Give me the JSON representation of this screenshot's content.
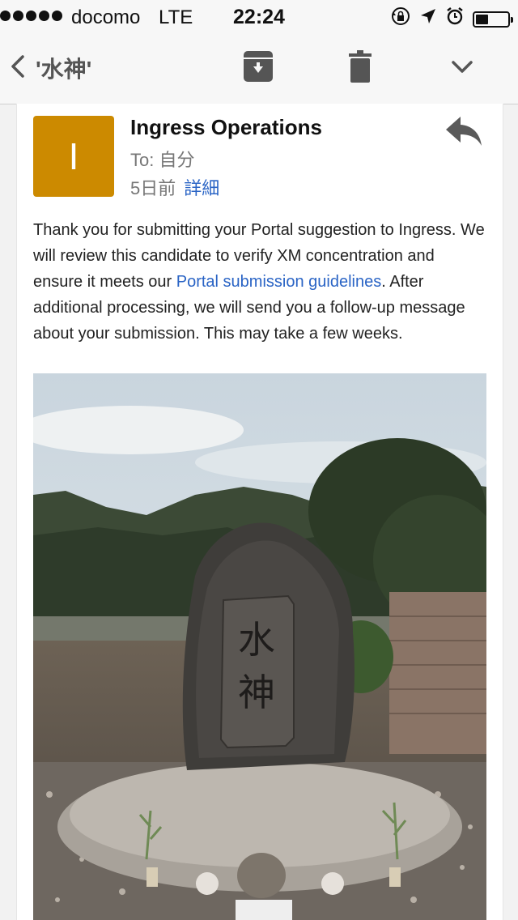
{
  "status_bar": {
    "carrier": "docomo",
    "network": "LTE",
    "time": "22:24",
    "signal_bars": 5,
    "battery_level_percent": 40
  },
  "nav": {
    "title": "'水神'",
    "back_icon": "chevron-left-icon",
    "archive_icon": "archive-icon",
    "delete_icon": "trash-icon",
    "more_icon": "chevron-down-icon"
  },
  "email": {
    "avatar_letter": "I",
    "avatar_color": "#cc8a00",
    "sender": "Ingress Operations",
    "to_label": "To: 自分",
    "date": "5日前",
    "details_link": "詳細",
    "reply_icon": "reply-icon",
    "body": {
      "part1": "Thank you for submitting your Portal suggestion to Ingress. We will review this candidate to verify XM concentration and ensure it meets our ",
      "link": "Portal submission guidelines",
      "part2": ". After additional processing, we will send you a follow-up message about your submission. This may take a few weeks."
    },
    "photo": {
      "stone_inscription": "水神"
    }
  },
  "colors": {
    "link": "#2a64c5",
    "icon_gray": "#555555"
  }
}
